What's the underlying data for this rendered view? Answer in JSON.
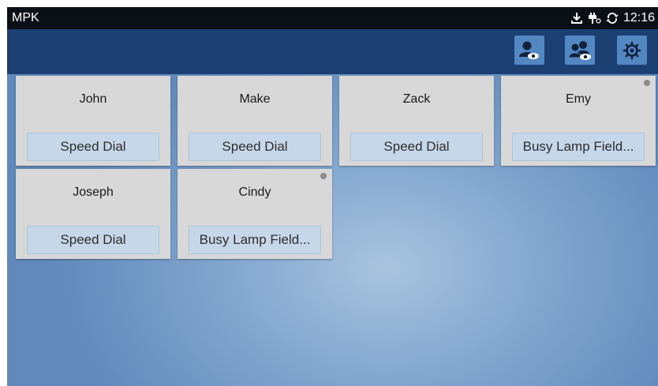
{
  "app": {
    "title": "MPK",
    "clock": "12:16"
  },
  "status_icons": [
    "download-icon",
    "usb-icon",
    "sync-icon"
  ],
  "toolbar": {
    "buttons": [
      "eye-contact-icon",
      "eye-group-icon",
      "settings-gear-icon"
    ]
  },
  "cards": [
    {
      "name": "John",
      "mode": "Speed Dial",
      "indicator": false
    },
    {
      "name": "Make",
      "mode": "Speed Dial",
      "indicator": false
    },
    {
      "name": "Zack",
      "mode": "Speed Dial",
      "indicator": false
    },
    {
      "name": "Emy",
      "mode": "Busy Lamp Field...",
      "indicator": true
    },
    {
      "name": "Joseph",
      "mode": "Speed Dial",
      "indicator": false
    },
    {
      "name": "Cindy",
      "mode": "Busy Lamp Field...",
      "indicator": true
    }
  ],
  "colors": {
    "status_bar": "#0b0f16",
    "toolbar": "#1c3f72",
    "toolbar_button": "#5387c2",
    "card": "#d8d8d8",
    "card_button": "#c6d7ea",
    "indicator_dot": "#8a8a8a"
  }
}
